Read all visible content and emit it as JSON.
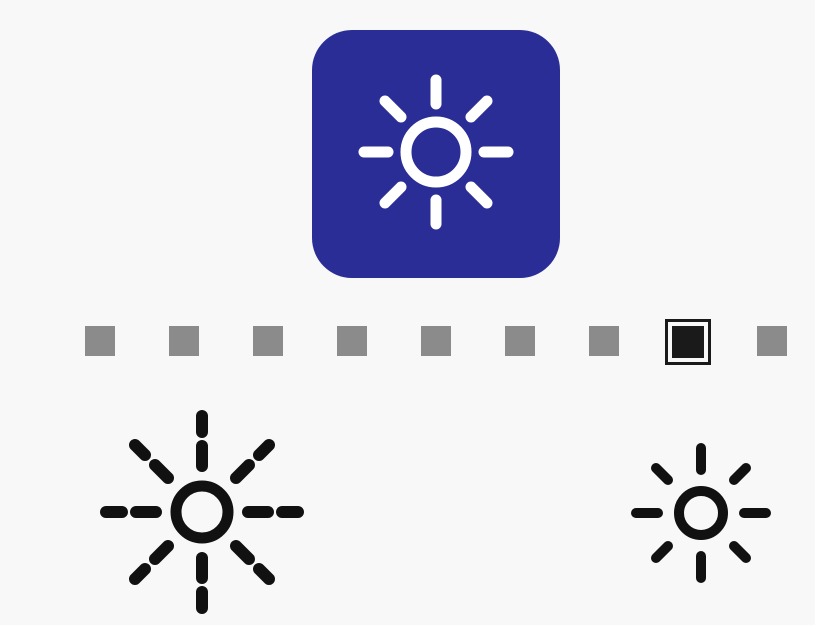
{
  "brightness": {
    "mode_icon": "sun-icon",
    "levels": 9,
    "selected_level": 8,
    "max_label_icon": "sun-bright-icon",
    "min_label_icon": "sun-dim-icon"
  },
  "colors": {
    "accent": "#2b2d96",
    "inactive_step": "#8b8b8b",
    "active_step": "#1a1a1a",
    "background": "#f8f8f8"
  }
}
